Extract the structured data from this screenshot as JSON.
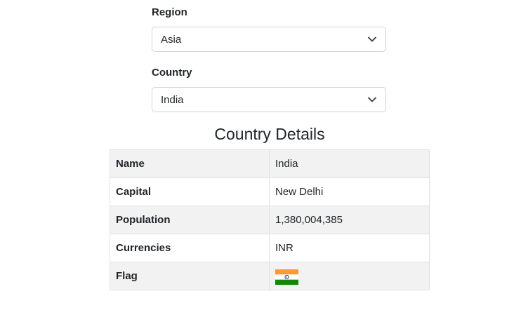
{
  "region": {
    "label": "Region",
    "selected": "Asia"
  },
  "country": {
    "label": "Country",
    "selected": "India"
  },
  "details": {
    "title": "Country Details",
    "rows": [
      {
        "key": "Name",
        "value": "India"
      },
      {
        "key": "Capital",
        "value": "New Delhi"
      },
      {
        "key": "Population",
        "value": "1,380,004,385"
      },
      {
        "key": "Currencies",
        "value": "INR"
      },
      {
        "key": "Flag",
        "value": ""
      }
    ]
  },
  "flag": {
    "icon": "india-flag-icon",
    "colors": {
      "saffron": "#FF9933",
      "white": "#FFFFFF",
      "green": "#138808",
      "chakra": "#000080"
    }
  }
}
